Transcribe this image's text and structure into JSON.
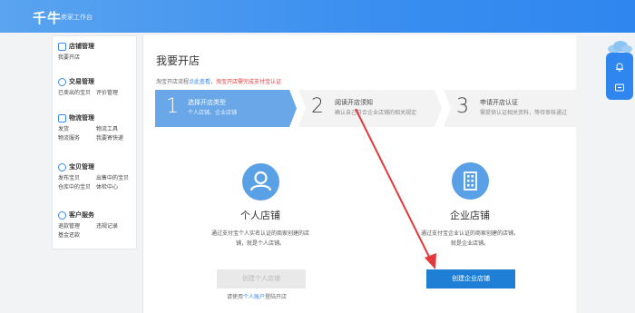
{
  "header": {
    "logo": "千牛",
    "subtitle": "卖家工作台"
  },
  "sidebar": {
    "groups": [
      {
        "title": "店铺管理",
        "icon": "shop-icon",
        "links": [
          "我要开店"
        ]
      },
      {
        "title": "交易管理",
        "icon": "trade-icon",
        "links": [
          "已卖出的宝贝",
          "评价管理"
        ]
      },
      {
        "title": "物流管理",
        "icon": "logistics-icon",
        "links": [
          "发货",
          "物流工具",
          "物流服务",
          "我要寄快递"
        ]
      },
      {
        "title": "宝贝管理",
        "icon": "goods-icon",
        "links": [
          "发布宝贝",
          "出售中的宝贝",
          "仓库中的宝贝",
          "体检中心"
        ]
      },
      {
        "title": "客户服务",
        "icon": "service-icon",
        "links": [
          "退款管理",
          "违规记录",
          "基金还款"
        ]
      }
    ]
  },
  "main": {
    "title": "我要开店",
    "notice": {
      "part1": "淘宝开店流程",
      "part2": "点此查看",
      "part3": "，",
      "part4": "淘宝开店需完成支付宝认证"
    },
    "steps": [
      {
        "num": "1",
        "title": "选择开店类型",
        "desc": "个人店铺、企业店铺"
      },
      {
        "num": "2",
        "title": "阅读开店须知",
        "desc": "确认自己符合企业店铺的相关规定"
      },
      {
        "num": "3",
        "title": "申请开店认证",
        "desc": "需提供认证相关资料，等待审核通过"
      }
    ],
    "personal": {
      "title": "个人店铺",
      "desc": "通过支付宝个人实名认证的商家创建的店铺，就是个人店铺。",
      "button": "创建个人店铺",
      "hint_prefix": "请使用",
      "hint_link": "个人账户",
      "hint_suffix": "登陆开店"
    },
    "enterprise": {
      "title": "企业店铺",
      "desc": "通过支付宝企业认证的商家创建的店铺，就是企业店铺。",
      "button": "创建企业店铺"
    }
  },
  "colors": {
    "accent": "#2f86ee",
    "step_active": "#6aa7e8",
    "primary_button": "#1e7fd4",
    "arrow": "#e4393c"
  }
}
